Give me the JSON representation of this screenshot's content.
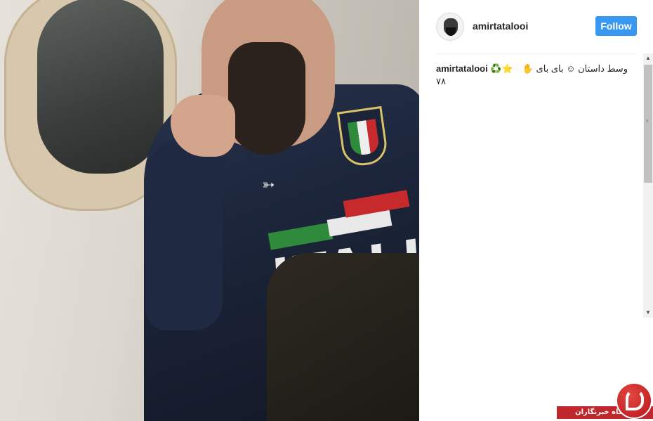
{
  "post": {
    "username": "amirtatalooi",
    "follow_label": "Follow",
    "caption": {
      "username": "amirtatalooi",
      "emoji": "♻️",
      "star": "⭐",
      "dot": "🏼",
      "hand": "✋",
      "text": "وسط داستان ☺ بای بای",
      "line2": "۷۸"
    }
  },
  "photo": {
    "jacket_text": "ITALIA"
  },
  "watermark": {
    "label": "باشگاه خبرنگاران"
  },
  "colors": {
    "follow_button": "#3897f0",
    "watermark_red": "#c0272d"
  }
}
